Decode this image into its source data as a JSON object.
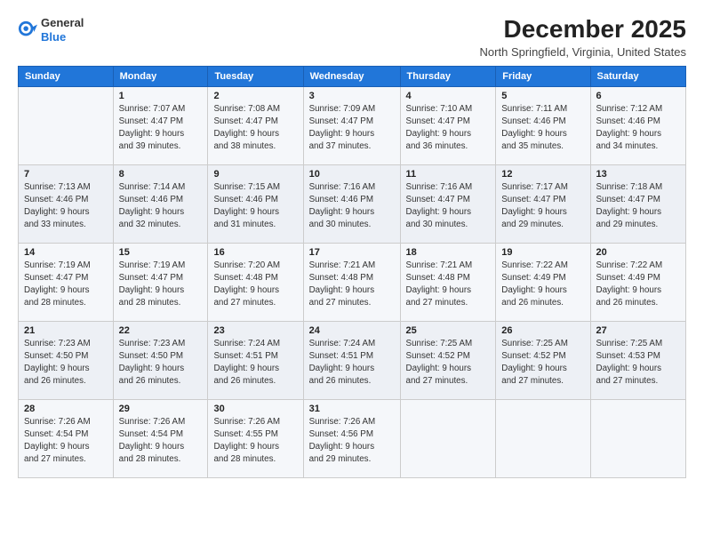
{
  "header": {
    "logo_general": "General",
    "logo_blue": "Blue",
    "month_title": "December 2025",
    "location": "North Springfield, Virginia, United States"
  },
  "days_of_week": [
    "Sunday",
    "Monday",
    "Tuesday",
    "Wednesday",
    "Thursday",
    "Friday",
    "Saturday"
  ],
  "weeks": [
    [
      {
        "day": "",
        "info": ""
      },
      {
        "day": "1",
        "info": "Sunrise: 7:07 AM\nSunset: 4:47 PM\nDaylight: 9 hours\nand 39 minutes."
      },
      {
        "day": "2",
        "info": "Sunrise: 7:08 AM\nSunset: 4:47 PM\nDaylight: 9 hours\nand 38 minutes."
      },
      {
        "day": "3",
        "info": "Sunrise: 7:09 AM\nSunset: 4:47 PM\nDaylight: 9 hours\nand 37 minutes."
      },
      {
        "day": "4",
        "info": "Sunrise: 7:10 AM\nSunset: 4:47 PM\nDaylight: 9 hours\nand 36 minutes."
      },
      {
        "day": "5",
        "info": "Sunrise: 7:11 AM\nSunset: 4:46 PM\nDaylight: 9 hours\nand 35 minutes."
      },
      {
        "day": "6",
        "info": "Sunrise: 7:12 AM\nSunset: 4:46 PM\nDaylight: 9 hours\nand 34 minutes."
      }
    ],
    [
      {
        "day": "7",
        "info": "Sunrise: 7:13 AM\nSunset: 4:46 PM\nDaylight: 9 hours\nand 33 minutes."
      },
      {
        "day": "8",
        "info": "Sunrise: 7:14 AM\nSunset: 4:46 PM\nDaylight: 9 hours\nand 32 minutes."
      },
      {
        "day": "9",
        "info": "Sunrise: 7:15 AM\nSunset: 4:46 PM\nDaylight: 9 hours\nand 31 minutes."
      },
      {
        "day": "10",
        "info": "Sunrise: 7:16 AM\nSunset: 4:46 PM\nDaylight: 9 hours\nand 30 minutes."
      },
      {
        "day": "11",
        "info": "Sunrise: 7:16 AM\nSunset: 4:47 PM\nDaylight: 9 hours\nand 30 minutes."
      },
      {
        "day": "12",
        "info": "Sunrise: 7:17 AM\nSunset: 4:47 PM\nDaylight: 9 hours\nand 29 minutes."
      },
      {
        "day": "13",
        "info": "Sunrise: 7:18 AM\nSunset: 4:47 PM\nDaylight: 9 hours\nand 29 minutes."
      }
    ],
    [
      {
        "day": "14",
        "info": "Sunrise: 7:19 AM\nSunset: 4:47 PM\nDaylight: 9 hours\nand 28 minutes."
      },
      {
        "day": "15",
        "info": "Sunrise: 7:19 AM\nSunset: 4:47 PM\nDaylight: 9 hours\nand 28 minutes."
      },
      {
        "day": "16",
        "info": "Sunrise: 7:20 AM\nSunset: 4:48 PM\nDaylight: 9 hours\nand 27 minutes."
      },
      {
        "day": "17",
        "info": "Sunrise: 7:21 AM\nSunset: 4:48 PM\nDaylight: 9 hours\nand 27 minutes."
      },
      {
        "day": "18",
        "info": "Sunrise: 7:21 AM\nSunset: 4:48 PM\nDaylight: 9 hours\nand 27 minutes."
      },
      {
        "day": "19",
        "info": "Sunrise: 7:22 AM\nSunset: 4:49 PM\nDaylight: 9 hours\nand 26 minutes."
      },
      {
        "day": "20",
        "info": "Sunrise: 7:22 AM\nSunset: 4:49 PM\nDaylight: 9 hours\nand 26 minutes."
      }
    ],
    [
      {
        "day": "21",
        "info": "Sunrise: 7:23 AM\nSunset: 4:50 PM\nDaylight: 9 hours\nand 26 minutes."
      },
      {
        "day": "22",
        "info": "Sunrise: 7:23 AM\nSunset: 4:50 PM\nDaylight: 9 hours\nand 26 minutes."
      },
      {
        "day": "23",
        "info": "Sunrise: 7:24 AM\nSunset: 4:51 PM\nDaylight: 9 hours\nand 26 minutes."
      },
      {
        "day": "24",
        "info": "Sunrise: 7:24 AM\nSunset: 4:51 PM\nDaylight: 9 hours\nand 26 minutes."
      },
      {
        "day": "25",
        "info": "Sunrise: 7:25 AM\nSunset: 4:52 PM\nDaylight: 9 hours\nand 27 minutes."
      },
      {
        "day": "26",
        "info": "Sunrise: 7:25 AM\nSunset: 4:52 PM\nDaylight: 9 hours\nand 27 minutes."
      },
      {
        "day": "27",
        "info": "Sunrise: 7:25 AM\nSunset: 4:53 PM\nDaylight: 9 hours\nand 27 minutes."
      }
    ],
    [
      {
        "day": "28",
        "info": "Sunrise: 7:26 AM\nSunset: 4:54 PM\nDaylight: 9 hours\nand 27 minutes."
      },
      {
        "day": "29",
        "info": "Sunrise: 7:26 AM\nSunset: 4:54 PM\nDaylight: 9 hours\nand 28 minutes."
      },
      {
        "day": "30",
        "info": "Sunrise: 7:26 AM\nSunset: 4:55 PM\nDaylight: 9 hours\nand 28 minutes."
      },
      {
        "day": "31",
        "info": "Sunrise: 7:26 AM\nSunset: 4:56 PM\nDaylight: 9 hours\nand 29 minutes."
      },
      {
        "day": "",
        "info": ""
      },
      {
        "day": "",
        "info": ""
      },
      {
        "day": "",
        "info": ""
      }
    ]
  ]
}
